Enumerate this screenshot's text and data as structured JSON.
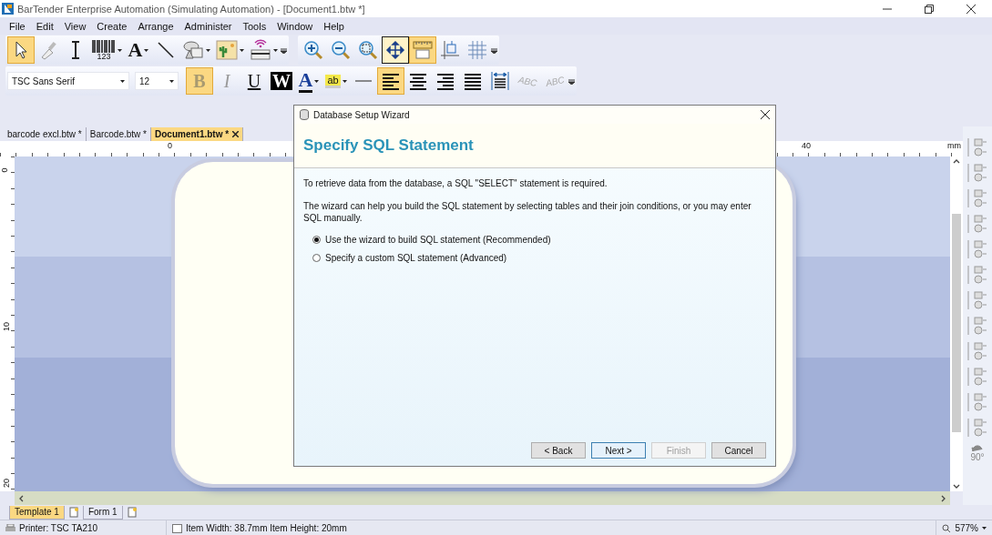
{
  "window": {
    "title": "BarTender Enterprise Automation (Simulating Automation) - [Document1.btw *]"
  },
  "menu": [
    "File",
    "Edit",
    "View",
    "Create",
    "Arrange",
    "Administer",
    "Tools",
    "Window",
    "Help"
  ],
  "toolbar_tools": [
    {
      "kind": "pointer",
      "selected": true
    },
    {
      "kind": "brush",
      "selected": false
    },
    {
      "kind": "cursor",
      "selected": false
    },
    {
      "kind": "barcode",
      "label": "123",
      "selected": false,
      "dropdown": true
    },
    {
      "kind": "text",
      "label": "A",
      "selected": false,
      "dropdown": true
    },
    {
      "kind": "line",
      "selected": false
    },
    {
      "kind": "shapes",
      "selected": false,
      "dropdown": true
    },
    {
      "kind": "picture",
      "selected": false,
      "dropdown": true
    },
    {
      "kind": "rfid",
      "selected": false,
      "dropdown": true
    }
  ],
  "toolbar_view": [
    {
      "kind": "zoom-in",
      "selected": false
    },
    {
      "kind": "zoom-out",
      "selected": false
    },
    {
      "kind": "zoom-area",
      "selected": false
    },
    {
      "kind": "fit",
      "selected": true
    },
    {
      "kind": "ruler",
      "selected": true
    },
    {
      "kind": "snap",
      "selected": false
    },
    {
      "kind": "grid",
      "selected": false
    }
  ],
  "font": {
    "family": "TSC Sans Serif",
    "size": "12"
  },
  "toolbar_format": [
    {
      "kind": "bold",
      "label": "B",
      "selected": true
    },
    {
      "kind": "italic",
      "label": "I",
      "selected": false
    },
    {
      "kind": "underline",
      "label": "U",
      "selected": false
    },
    {
      "kind": "reverse",
      "label": "W",
      "selected": false
    },
    {
      "kind": "color",
      "label": "A",
      "selected": false,
      "dropdown": true
    },
    {
      "kind": "highlight",
      "label": "ab",
      "selected": false,
      "dropdown": true
    },
    {
      "kind": "rule",
      "selected": false
    },
    {
      "kind": "align-left",
      "selected": true
    },
    {
      "kind": "align-center",
      "selected": false
    },
    {
      "kind": "align-right",
      "selected": false
    },
    {
      "kind": "justify",
      "selected": false
    },
    {
      "kind": "fit-width",
      "selected": false
    },
    {
      "kind": "arc-up",
      "label": "ABC",
      "selected": false
    },
    {
      "kind": "arc-down",
      "label": "ABC",
      "selected": false
    }
  ],
  "document_tabs": [
    {
      "label": "barcode excl.btw *",
      "selected": false
    },
    {
      "label": "Barcode.btw *",
      "selected": false
    },
    {
      "label": "Document1.btw *",
      "selected": true
    }
  ],
  "ruler": {
    "horizontal": [
      "0",
      "40"
    ],
    "unit": "mm",
    "vertical": [
      "0",
      "10",
      "20"
    ]
  },
  "dialog": {
    "title": "Database Setup Wizard",
    "heading": "Specify SQL Statement",
    "paragraphs": [
      "To retrieve data from the database, a SQL \"SELECT\" statement is required.",
      "The wizard can help you build the SQL statement by selecting tables and their join conditions, or you may enter SQL manually."
    ],
    "options": [
      {
        "label": "Use the wizard to build SQL statement (Recommended)",
        "selected": true
      },
      {
        "label": "Specify a custom SQL statement (Advanced)",
        "selected": false
      }
    ],
    "buttons": [
      {
        "label": "< Back",
        "disabled": false,
        "focused": false
      },
      {
        "label": "Next >",
        "disabled": false,
        "focused": true
      },
      {
        "label": "Finish",
        "disabled": true,
        "focused": false
      },
      {
        "label": "Cancel",
        "disabled": false,
        "focused": false
      }
    ]
  },
  "align_toolbar": {
    "rotate": "90°"
  },
  "sheet_tabs": [
    {
      "label": "Template 1",
      "selected": true
    },
    {
      "label": "Form 1",
      "selected": false
    }
  ],
  "status_bar": {
    "printer": "Printer: TSC TA210",
    "item_size": "Item Width: 38.7mm  Item Height: 20mm",
    "zoom": "577%"
  }
}
